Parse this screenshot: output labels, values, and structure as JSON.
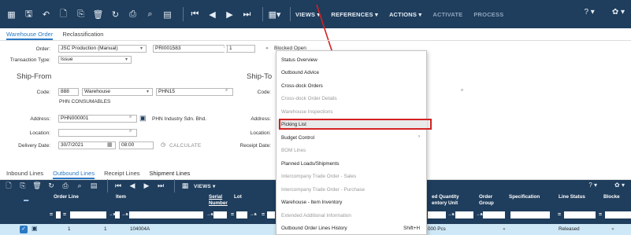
{
  "toolbar": {
    "menus": [
      "VIEWS ▾",
      "REFERENCES ▾",
      "ACTIONS ▾"
    ],
    "dim_menus": [
      "ACTIVATE",
      "PROCESS"
    ],
    "help": "? ▾",
    "settings": "✿ ▾"
  },
  "tabs": [
    "Warehouse Order",
    "Reclassification"
  ],
  "form": {
    "order_label": "Order:",
    "order_type": "JSC Production (Manual)",
    "order_no": "PRI001583",
    "order_seq": "1",
    "blocked_partial": "Blocked    Open",
    "transaction_type_label": "Transaction Type:",
    "transaction_type": "Issue",
    "ship_from": "Ship-From",
    "ship_to": "Ship-To",
    "code_label": "Code:",
    "code_value": "888",
    "code_type": "Warehouse",
    "code_id": "PHN15",
    "code_desc": "PHN CONSUMABLES",
    "code_label_to": "Code:",
    "address_label": "Address:",
    "address_value": "PHN000001",
    "address_desc": "PHN Industry Sdn. Bhd.",
    "address_label_to": "Address:",
    "location_label": "Location:",
    "location_label_to": "Location:",
    "delivery_date_label": "Delivery Date:",
    "delivery_date": "30/7/2021",
    "delivery_time": "08:00",
    "calculate": "CALCULATE",
    "receipt_date_label": "Receipt Date:"
  },
  "line_tabs": [
    "Inbound Lines",
    "Outbound Lines",
    "Receipt Lines",
    "Shipment Lines"
  ],
  "line_toolbar": {
    "views": "VIEWS ▾",
    "help": "? ▾",
    "settings": "✿ ▾"
  },
  "grid": {
    "headers": {
      "order_line": "Order Line",
      "item": "Item",
      "serial": "Serial",
      "serial2": "Number",
      "lot": "Lot",
      "qty": "ed Quantity",
      "qty2": "entory Unit",
      "order": "Order",
      "order2": "Group",
      "spec": "Specification",
      "status": "Line Status",
      "blocked": "Blocke"
    },
    "row": {
      "line": "1",
      "seq": "1",
      "item": "104004A",
      "qty": "000  Pcs",
      "status": "Released"
    }
  },
  "context_menu": {
    "items": [
      {
        "label": "Status Overview",
        "enabled": true
      },
      {
        "label": "Outbound Advice",
        "enabled": true
      },
      {
        "label": "Cross-dock Orders",
        "enabled": true
      },
      {
        "label": "Cross-dock Order Details",
        "enabled": false
      },
      {
        "label": "Warehouse Inspections",
        "enabled": false
      },
      {
        "label": "Picking List",
        "enabled": true
      },
      {
        "label": "Budget Control",
        "enabled": true
      },
      {
        "label": "BOM Lines",
        "enabled": false
      },
      {
        "label": "Planned Loads/Shipments",
        "enabled": true
      },
      {
        "label": "Intercompany Trade Order - Sales",
        "enabled": false
      },
      {
        "label": "Intercompany Trade Order - Purchase",
        "enabled": false
      },
      {
        "label": "Warehouse - Item Inventory",
        "enabled": true
      },
      {
        "label": "Extended Additional Information",
        "enabled": false
      },
      {
        "label": "Outbound Order Lines History",
        "enabled": true
      }
    ],
    "shortcut": "Shift+H",
    "submenu_arrow": "›"
  },
  "colors": {
    "toolbar": "#1f3d5c",
    "accent": "#2a79c3",
    "highlight_box": "#d32222",
    "row_selected": "#cfe8f7"
  }
}
